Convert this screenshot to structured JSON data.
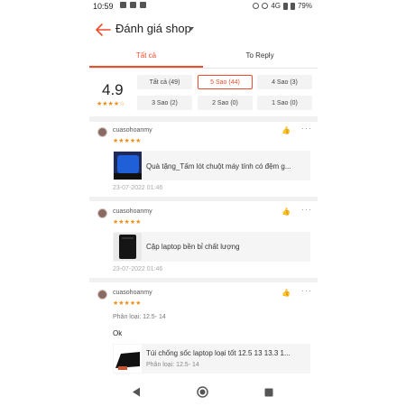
{
  "status_bar": {
    "time": "10:59",
    "network": "4G",
    "battery": "79%"
  },
  "header": {
    "title": "Đánh giá shop"
  },
  "tabs": [
    {
      "label": "Tất cả",
      "active": true
    },
    {
      "label": "To Reply",
      "active": false
    }
  ],
  "rating": {
    "score": "4.9",
    "stars": "★★★★☆",
    "filters": [
      {
        "label": "Tất cả (49)",
        "active": false
      },
      {
        "label": "5 Sao (44)",
        "active": true
      },
      {
        "label": "4 Sao (3)",
        "active": false
      },
      {
        "label": "3 Sao (2)",
        "active": false
      },
      {
        "label": "2 Sao (0)",
        "active": false
      },
      {
        "label": "1 Sao (0)",
        "active": false
      }
    ]
  },
  "reviews": [
    {
      "username": "cuasohoanmy",
      "stars": "★★★★★",
      "product": "Quà tặng_Tấm lót chuột máy tính có đệm g...",
      "date": "23-07-2022 01:46"
    },
    {
      "username": "cuasohoanmy",
      "stars": "★★★★★",
      "product": "Cặp laptop bền bỉ chất lượng",
      "date": "23-07-2022 01:46"
    },
    {
      "username": "cuasohoanmy",
      "stars": "★★★★★",
      "variant": "Phân loại: 12.5- 14",
      "comment": "Ok",
      "product": "Túi chống sốc laptop loại tốt 12.5 13 13.3 1...",
      "product_variant": "Phân loại: 12.5- 14"
    }
  ],
  "colors": {
    "accent": "#ee4d2d",
    "star": "#ee8f1d"
  },
  "icons": [
    "back-arrow-icon",
    "caret-down-icon",
    "thumbs-up-icon",
    "more-icon",
    "nav-back-icon",
    "nav-home-icon",
    "nav-recents-icon"
  ]
}
